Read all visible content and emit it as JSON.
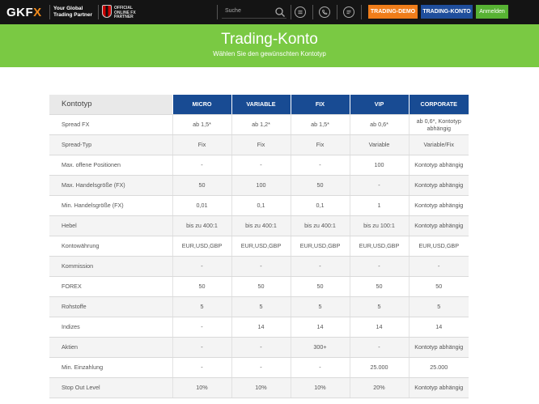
{
  "header": {
    "logo_text_main": "GKF",
    "logo_text_accent": "X",
    "tagline_line1": "Your Global",
    "tagline_line2": "Trading Partner",
    "partner_line1": "OFFICIAL",
    "partner_line2": "ONLINE FX",
    "partner_line3": "PARTNER",
    "search_placeholder": "Suche",
    "icons": [
      "search-icon",
      "globe-icon",
      "phone-icon",
      "chat-icon"
    ],
    "buttons": {
      "demo": "TRADING-DEMO",
      "konto": "TRADING-KONTO",
      "login": "Anmelden"
    },
    "colors": {
      "bar": "#141414",
      "demo": "#f07d1a",
      "konto": "#1f4e9c",
      "login": "#57b233"
    }
  },
  "banner": {
    "title": "Trading-Konto",
    "subtitle": "Wählen Sie den gewünschten Kontotyp",
    "color": "#7ac943"
  },
  "table": {
    "corner_label": "Kontotyp",
    "columns": [
      "MICRO",
      "VARIABLE",
      "FIX",
      "VIP",
      "CORPORATE"
    ],
    "header_color": "#184b93",
    "rows": [
      {
        "label": "Spread FX",
        "cells": [
          "ab 1,5*",
          "ab 1,2*",
          "ab 1,5*",
          "ab 0,6*",
          "ab 0,6*, Kontotyp abhängig"
        ]
      },
      {
        "label": "Spread-Typ",
        "cells": [
          "Fix",
          "Fix",
          "Fix",
          "Variable",
          "Variable/Fix"
        ]
      },
      {
        "label": "Max. offene Positionen",
        "cells": [
          "-",
          "-",
          "-",
          "100",
          "Kontotyp abhängig"
        ]
      },
      {
        "label": "Max. Handelsgröße (FX)",
        "cells": [
          "50",
          "100",
          "50",
          "-",
          "Kontotyp abhängig"
        ]
      },
      {
        "label": "Min. Handelsgröße (FX)",
        "cells": [
          "0,01",
          "0,1",
          "0,1",
          "1",
          "Kontotyp abhängig"
        ]
      },
      {
        "label": "Hebel",
        "cells": [
          "bis zu 400:1",
          "bis zu 400:1",
          "bis zu 400:1",
          "bis zu 100:1",
          "Kontotyp abhängig"
        ]
      },
      {
        "label": "Kontowährung",
        "cells": [
          "EUR,USD,GBP",
          "EUR,USD,GBP",
          "EUR,USD,GBP",
          "EUR,USD,GBP",
          "EUR,USD,GBP"
        ]
      },
      {
        "label": "Kommission",
        "cells": [
          "-",
          "-",
          "-",
          "-",
          "-"
        ]
      },
      {
        "label": "FOREX",
        "cells": [
          "50",
          "50",
          "50",
          "50",
          "50"
        ]
      },
      {
        "label": "Rohstoffe",
        "cells": [
          "5",
          "5",
          "5",
          "5",
          "5"
        ]
      },
      {
        "label": "Indizes",
        "cells": [
          "-",
          "14",
          "14",
          "14",
          "14"
        ]
      },
      {
        "label": "Aktien",
        "cells": [
          "-",
          "-",
          "300+",
          "-",
          "Kontotyp abhängig"
        ]
      },
      {
        "label": "Min. Einzahlung",
        "cells": [
          "-",
          "-",
          "-",
          "25.000",
          "25.000"
        ]
      },
      {
        "label": "Stop Out Level",
        "cells": [
          "10%",
          "10%",
          "10%",
          "20%",
          "Kontotyp abhängig"
        ]
      }
    ]
  }
}
